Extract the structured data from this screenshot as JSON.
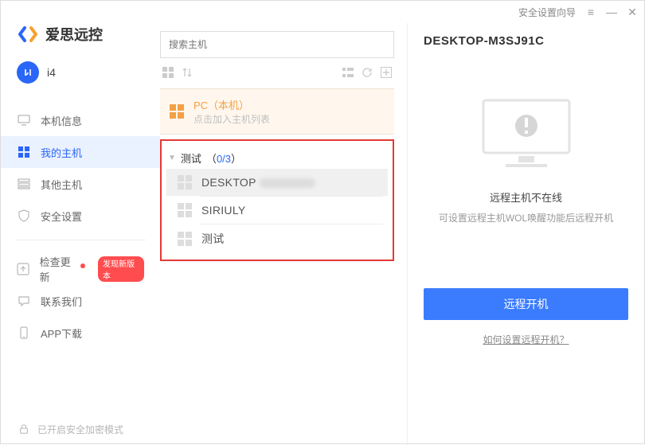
{
  "titlebar": {
    "security_wizard": "安全设置向导"
  },
  "app": {
    "name": "爱思远控"
  },
  "profile": {
    "name": "i4"
  },
  "sidebar": {
    "items": [
      {
        "label": "本机信息"
      },
      {
        "label": "我的主机"
      },
      {
        "label": "其他主机"
      },
      {
        "label": "安全设置"
      }
    ],
    "secondary": [
      {
        "label": "检查更新",
        "pill": "发现新版本"
      },
      {
        "label": "联系我们"
      },
      {
        "label": "APP下载"
      }
    ],
    "footer": "已开启安全加密模式"
  },
  "search": {
    "placeholder": "搜索主机"
  },
  "pc_card": {
    "title": "PC（本机）",
    "sub": "点击加入主机列表"
  },
  "group": {
    "name": "测试",
    "count": "0/3",
    "hosts": [
      {
        "name": "DESKTOP",
        "redacted": true
      },
      {
        "name": "SIRIULY"
      },
      {
        "name": "测试"
      }
    ]
  },
  "details": {
    "title": "DESKTOP-M3SJ91C",
    "offline": "远程主机不在线",
    "hint": "可设置远程主机WOL唤醒功能后远程开机",
    "button": "远程开机",
    "link": "如何设置远程开机？"
  }
}
